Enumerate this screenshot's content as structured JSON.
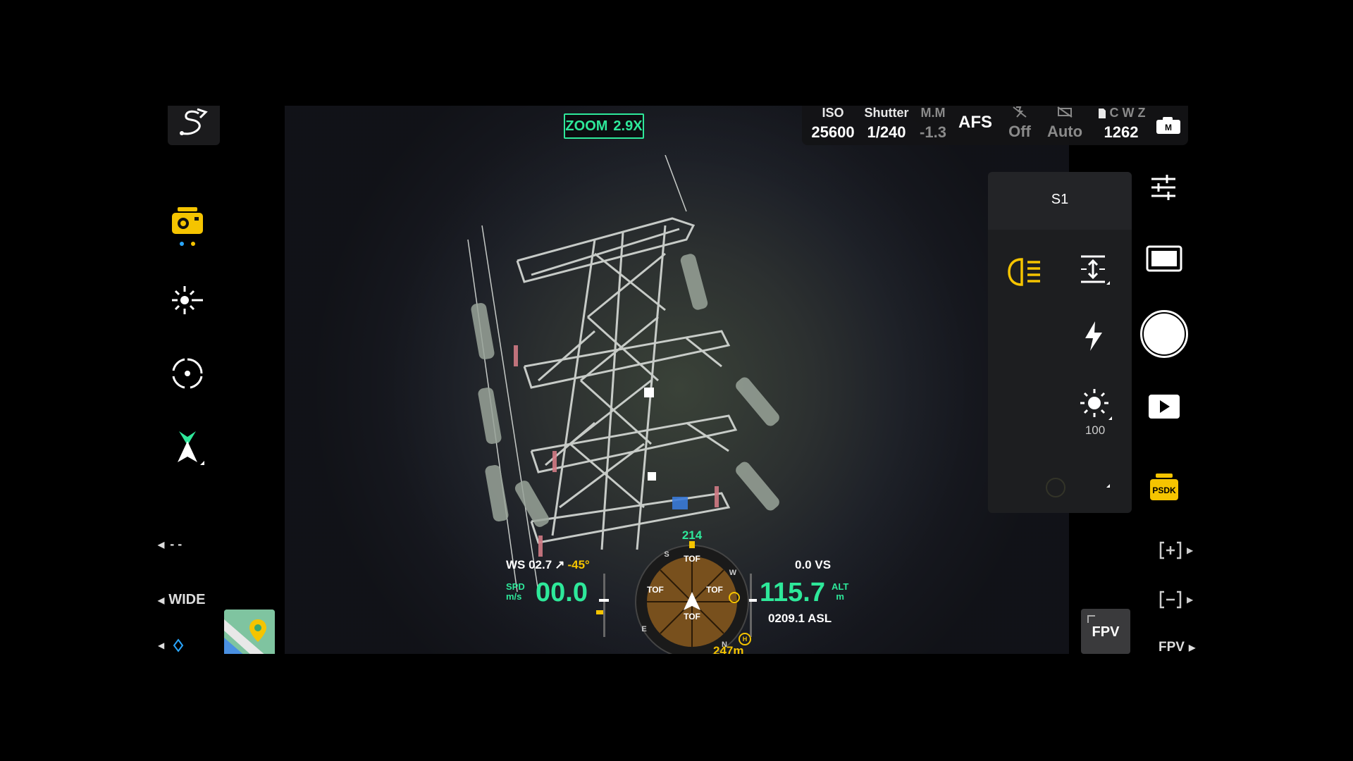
{
  "zoom": {
    "label": "ZOOM",
    "value": "2.9X"
  },
  "camera_settings": {
    "iso": {
      "label": "ISO",
      "value": "25600"
    },
    "shutter": {
      "label": "Shutter",
      "value": "1/240"
    },
    "ev": {
      "label": "M.M",
      "value": "-1.3"
    },
    "focus": "AFS",
    "flash": {
      "value": "Off"
    },
    "wb": {
      "value": "Auto"
    },
    "storage": {
      "label": "C W Z",
      "value": "1262"
    }
  },
  "light_panel": {
    "title": "S1",
    "brightness_value": "100"
  },
  "left_toolbar": {
    "lens_label": "WIDE",
    "dash_label": "- -"
  },
  "flight": {
    "ws_label": "WS 02.7",
    "ws_dir": "-45°",
    "spd_label": "SPD",
    "spd_unit": "m/s",
    "speed": "00.0",
    "vs": "0.0 VS",
    "altitude": "115.7",
    "alt_label": "ALT",
    "alt_unit": "m",
    "asl": "0209.1 ASL",
    "heading": "214",
    "home_distance": "247m",
    "compass_labels": [
      "TOF",
      "TOF",
      "TOF",
      "TOF"
    ]
  },
  "right_toolbar": {
    "psdk_label": "PSDK",
    "fpv_bottom": "FPV",
    "fpv_button": "FPV"
  },
  "colors": {
    "accent_green": "#2ee89a",
    "accent_yellow": "#f5c400"
  }
}
